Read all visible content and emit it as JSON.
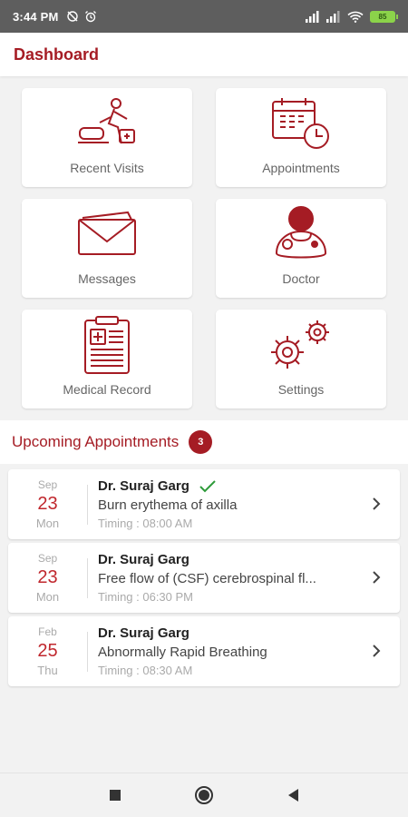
{
  "status_bar": {
    "time": "3:44 PM",
    "battery": "85"
  },
  "header": {
    "title": "Dashboard"
  },
  "tiles": [
    {
      "label": "Recent Visits",
      "icon": "recent-visits-icon"
    },
    {
      "label": "Appointments",
      "icon": "calendar-clock-icon"
    },
    {
      "label": "Messages",
      "icon": "envelope-icon"
    },
    {
      "label": "Doctor",
      "icon": "doctor-icon"
    },
    {
      "label": "Medical Record",
      "icon": "clipboard-icon"
    },
    {
      "label": "Settings",
      "icon": "gears-icon"
    }
  ],
  "upcoming": {
    "title": "Upcoming Appointments",
    "count": "3",
    "items": [
      {
        "month": "Sep",
        "day": "23",
        "weekday": "Mon",
        "doctor": "Dr. Suraj Garg",
        "reason": "Burn erythema of axilla",
        "timing": "Timing : 08:00 AM",
        "confirmed": true
      },
      {
        "month": "Sep",
        "day": "23",
        "weekday": "Mon",
        "doctor": "Dr. Suraj Garg",
        "reason": "Free flow of (CSF) cerebrospinal fl...",
        "timing": "Timing : 06:30 PM",
        "confirmed": false
      },
      {
        "month": "Feb",
        "day": "25",
        "weekday": "Thu",
        "doctor": "Dr. Suraj Garg",
        "reason": "Abnormally Rapid Breathing",
        "timing": "Timing : 08:30 AM",
        "confirmed": false
      }
    ]
  },
  "colors": {
    "accent": "#a51c24",
    "date_red": "#c0272d",
    "check_green": "#2e9b3a",
    "status_bar": "#5e5e5e"
  }
}
